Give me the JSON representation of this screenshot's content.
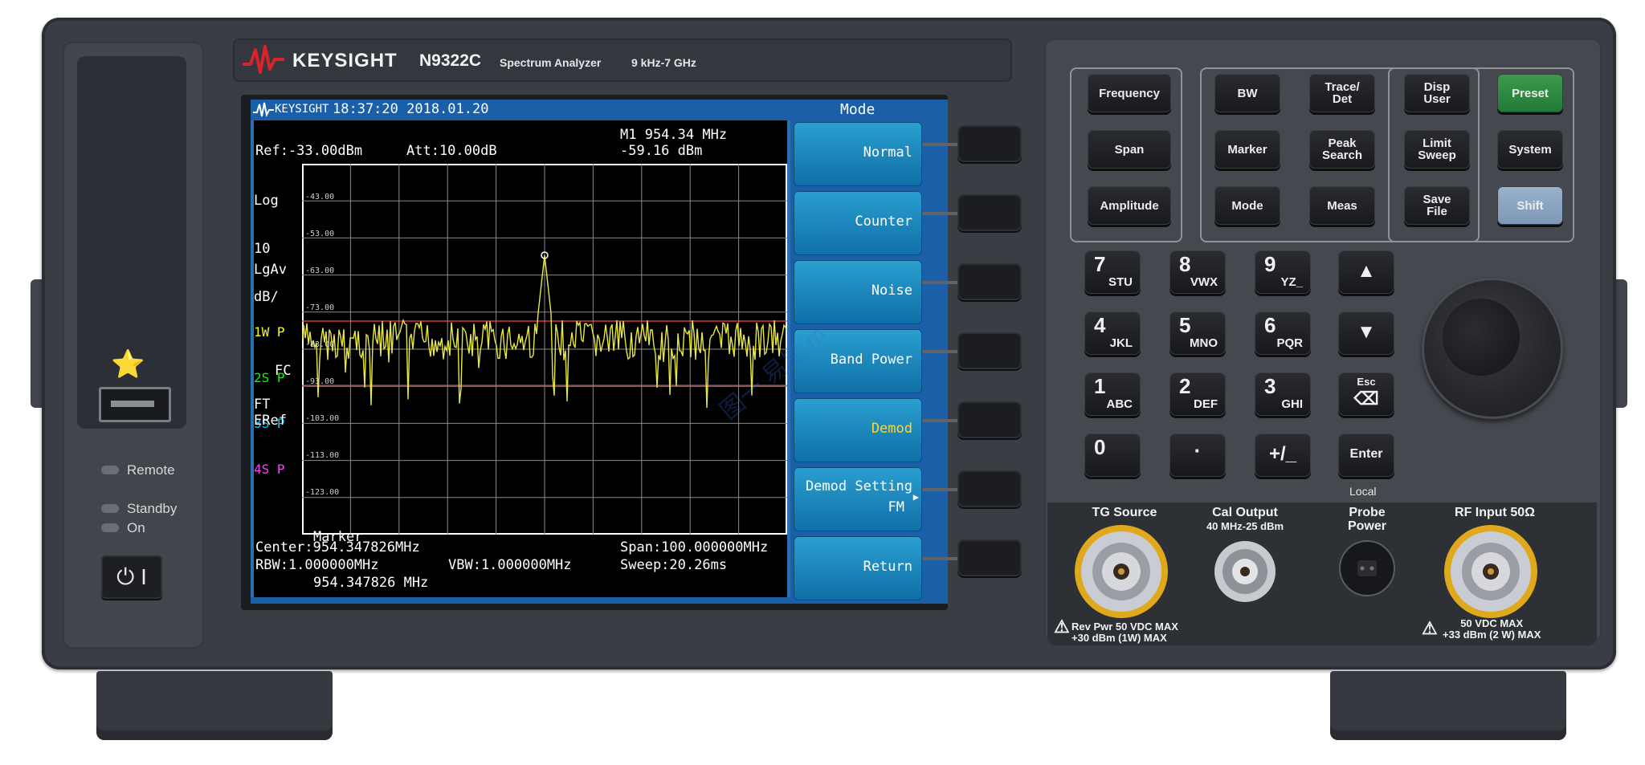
{
  "brand": {
    "name": "KEYSIGHT",
    "model": "N9322C",
    "description": "Spectrum Analyzer",
    "freq_range": "9 kHz-7 GHz"
  },
  "left_panel": {
    "remote_label": "Remote",
    "standby_label": "Standby",
    "on_label": "On",
    "power_symbol": "⏻ I"
  },
  "screen": {
    "top_brand": "KEYSIGHT",
    "datetime": "18:37:20 2018.01.20",
    "menu_title": "Mode",
    "ref": "Ref:-33.00dBm",
    "att": "Att:10.00dB",
    "marker_freq": "M1 954.34 MHz",
    "marker_amp": "-59.16 dBm",
    "scale_lines": [
      "Log",
      "10",
      "dB/"
    ],
    "avg": "LgAv",
    "traces": [
      {
        "label": "1W P",
        "color": "#ffff00"
      },
      {
        "label": "2S P",
        "color": "#00ff00"
      },
      {
        "label": "3S P",
        "color": "#00c8ff"
      },
      {
        "label": "4S P",
        "color": "#ff40ff"
      }
    ],
    "fc": "FC",
    "ft": "FT",
    "eref": "ERef",
    "grid_labels": [
      "-43.00",
      "-53.00",
      "-63.00",
      "-73.00",
      "-83.00",
      "-93.00",
      "-103.00",
      "-113.00",
      "-123.00"
    ],
    "marker_box": [
      "Marker",
      "954.347826 MHz"
    ],
    "center": "Center:954.347826MHz",
    "span": "Span:100.000000MHz",
    "rbw": "RBW:1.000000MHz",
    "vbw": "VBW:1.000000MHz",
    "sweep": "Sweep:20.26ms"
  },
  "softkeys": [
    {
      "label": "Normal"
    },
    {
      "label": "Counter"
    },
    {
      "label": "Noise"
    },
    {
      "label": "Band Power"
    },
    {
      "label": "Demod"
    },
    {
      "label": "Demod Setting",
      "sub": "FM"
    },
    {
      "label": "Return"
    }
  ],
  "keys": {
    "frequency": "Frequency",
    "span": "Span",
    "amplitude": "Amplitude",
    "bw": "BW",
    "trace_det": "Trace/\nDet",
    "disp_user": "Disp\nUser",
    "marker": "Marker",
    "peak_search": "Peak\nSearch",
    "limit_sweep": "Limit\nSweep",
    "mode": "Mode",
    "meas": "Meas",
    "save_file": "Save\nFile",
    "preset": "Preset",
    "system": "System",
    "shift": "Shift"
  },
  "numpad": [
    {
      "num": "7",
      "sub": "STU"
    },
    {
      "num": "8",
      "sub": "VWX"
    },
    {
      "num": "9",
      "sub": "YZ_"
    },
    {
      "num": "4",
      "sub": "JKL"
    },
    {
      "num": "5",
      "sub": "MNO"
    },
    {
      "num": "6",
      "sub": "PQR"
    },
    {
      "num": "1",
      "sub": "ABC"
    },
    {
      "num": "2",
      "sub": "DEF"
    },
    {
      "num": "3",
      "sub": "GHI"
    },
    {
      "num": "0",
      "sub": ""
    },
    {
      "num": "·",
      "sub": ""
    },
    {
      "num": "+/_",
      "sub": ""
    }
  ],
  "nav": {
    "up": "▲",
    "down": "▼",
    "esc": "Esc",
    "esc_symbol": "⌫",
    "enter": "Enter",
    "local": "Local"
  },
  "connectors": {
    "tg_source": "TG Source",
    "cal_output": "Cal Output",
    "cal_output_sub": "40 MHz-25 dBm",
    "probe_power": "Probe\nPower",
    "rf_input": "RF Input 50Ω",
    "tg_warning": [
      "Rev Pwr 50 VDC MAX",
      "+30 dBm (1W) MAX"
    ],
    "rf_warning": [
      "50 VDC MAX",
      "+33 dBm (2 W) MAX"
    ]
  },
  "watermark": "图一 易星 m"
}
